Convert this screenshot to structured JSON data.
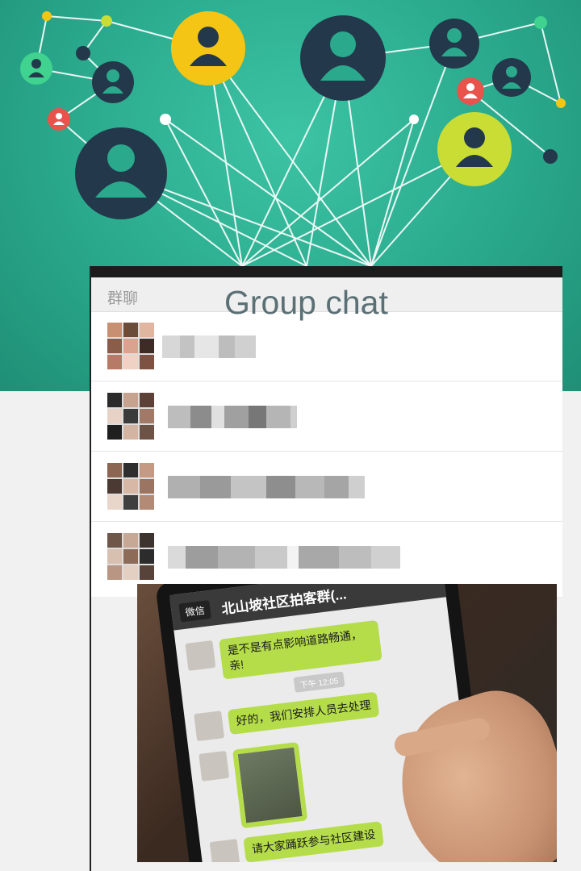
{
  "banner": {
    "colors": {
      "teal": "#2aa98c",
      "navy": "#23384a",
      "yellow": "#f5c515",
      "lime": "#c9dd35",
      "red": "#e8534b",
      "green": "#3fd38f"
    },
    "icons": [
      "user-icon"
    ]
  },
  "chat_list": {
    "header_label": "群聊",
    "overlay_title": "Group chat",
    "rows": [
      {
        "name": "blurred-group-name-1"
      },
      {
        "name": "blurred-group-name-2"
      },
      {
        "name": "blurred-group-name-3"
      },
      {
        "name": "blurred-group-name-4"
      }
    ]
  },
  "phone_photo": {
    "back_label": "微信",
    "chat_name": "北山坡社区拍客群(...",
    "messages": [
      {
        "text": "是不是有点影响道路畅通，亲!"
      },
      {
        "text": "好的，我们安排人员去处理"
      },
      {
        "text": "请大家踊跃参与社区建设"
      }
    ],
    "time_label": "下午 12:05"
  }
}
